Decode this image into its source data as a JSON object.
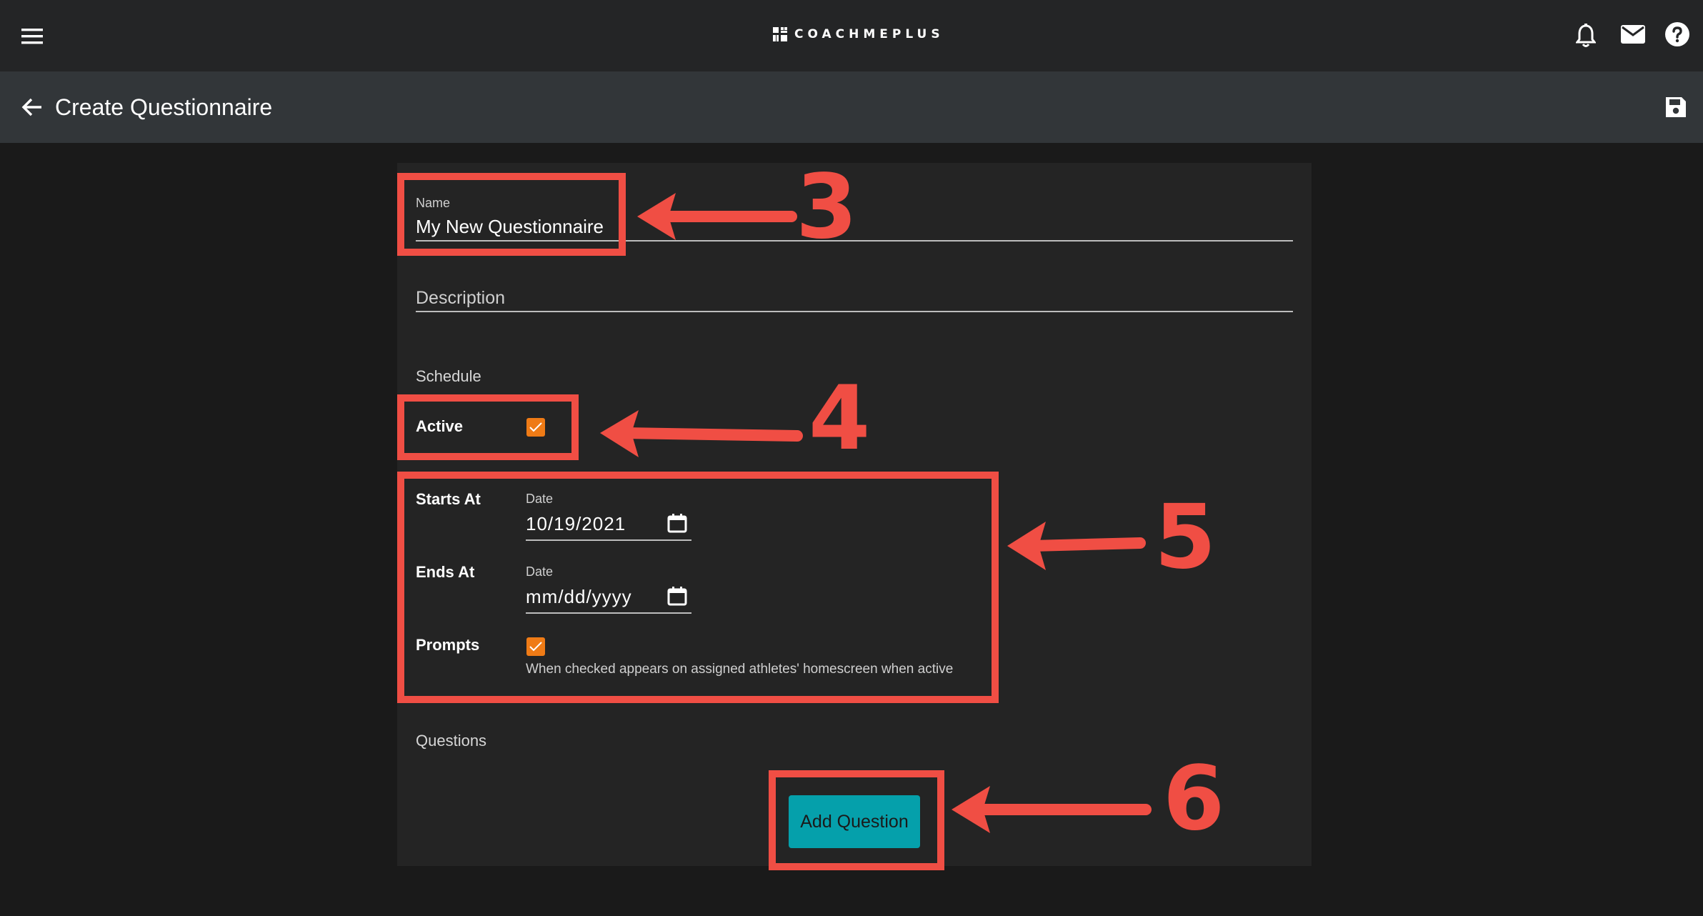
{
  "topbar": {
    "brand": "COACHMEPLUS",
    "icons": [
      "menu-icon",
      "logo-icon",
      "bell-icon",
      "mail-icon",
      "help-icon"
    ]
  },
  "subheader": {
    "title": "Create Questionnaire",
    "icons": [
      "back-arrow-icon",
      "save-icon"
    ]
  },
  "form": {
    "name": {
      "label": "Name",
      "value": "My New Questionnaire"
    },
    "description": {
      "placeholder": "Description"
    },
    "schedule": {
      "section_label": "Schedule",
      "active": {
        "label": "Active",
        "checked": true
      },
      "starts_at": {
        "label": "Starts At",
        "date_label": "Date",
        "value": "10/19/2021"
      },
      "ends_at": {
        "label": "Ends At",
        "date_label": "Date",
        "value": "mm/dd/yyyy"
      },
      "prompts": {
        "label": "Prompts",
        "checked": true,
        "helper": "When checked appears on assigned athletes' homescreen when active"
      }
    },
    "questions": {
      "section_label": "Questions",
      "add_button": "Add Question"
    }
  },
  "annotations": {
    "steps": [
      "3",
      "4",
      "5",
      "6"
    ],
    "color": "#f04e44"
  },
  "colors": {
    "accent_checkbox": "#ef7b16",
    "button": "#05a0ab",
    "topbar": "#242526",
    "subbar": "#323639",
    "card": "#242424",
    "background": "#1a1a1a"
  }
}
